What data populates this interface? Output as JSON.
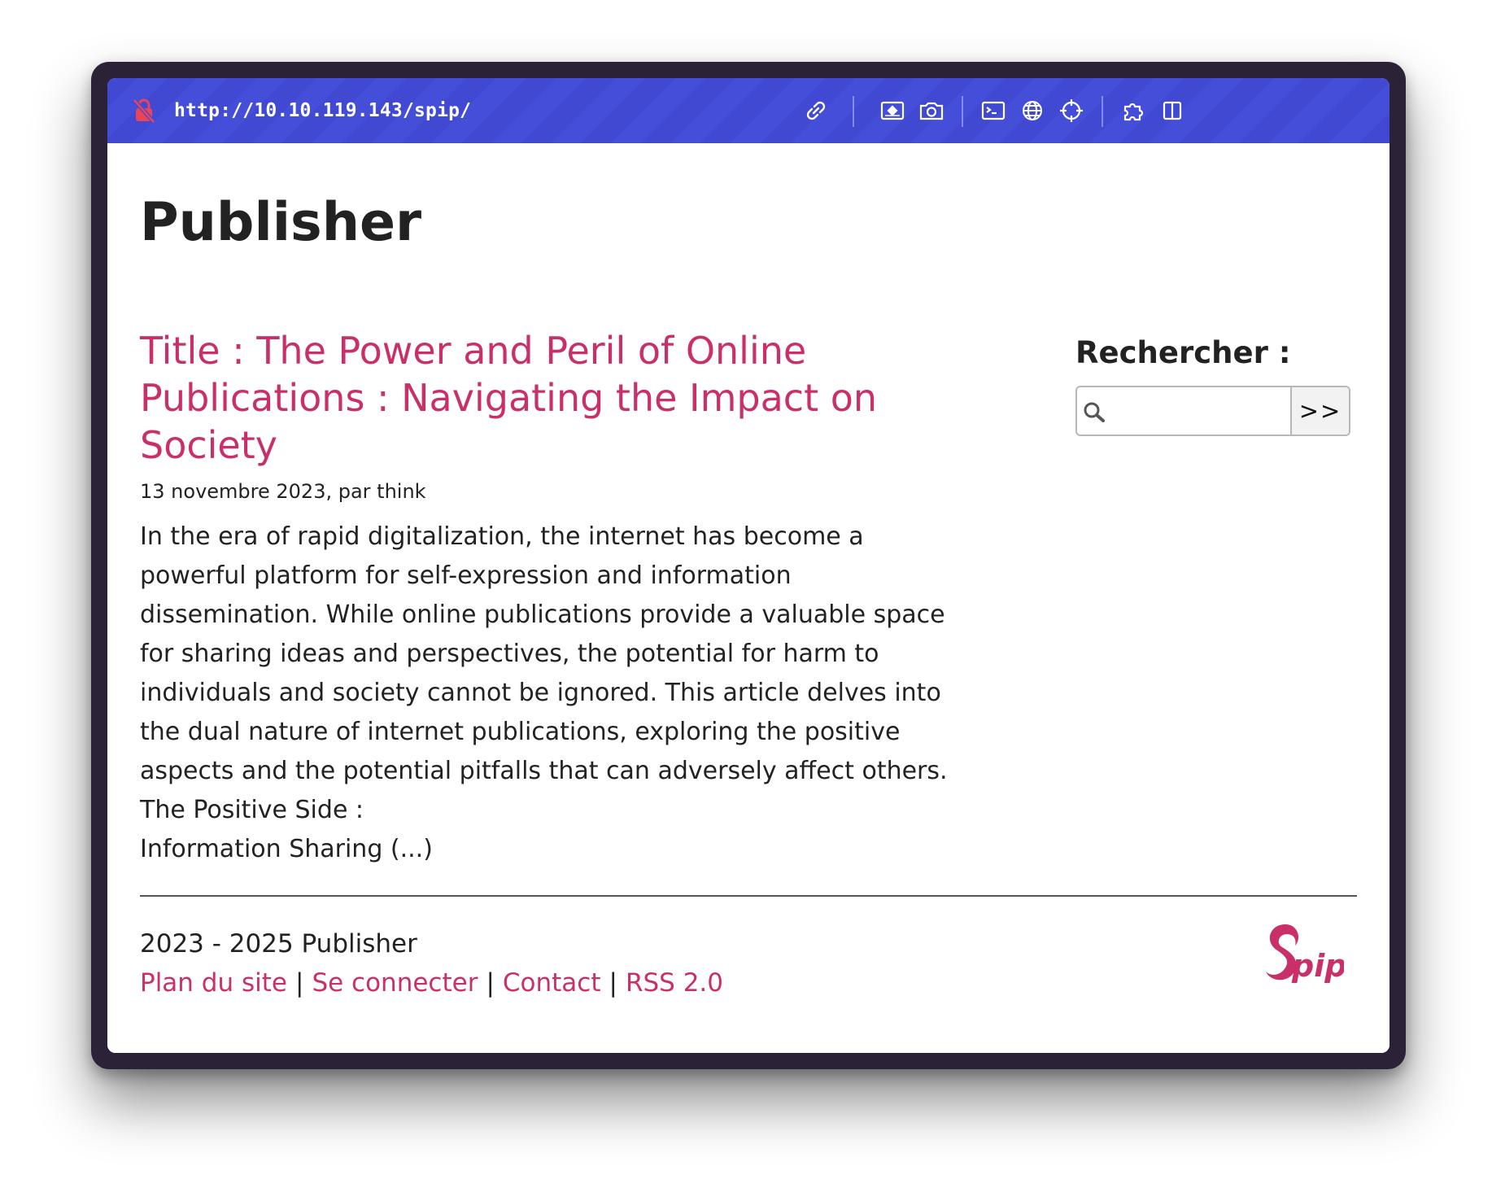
{
  "browser": {
    "url": "http://10.10.119.143/spip/",
    "icons": [
      "lock-slash-icon",
      "link-icon",
      "screenshot-area-icon",
      "camera-icon",
      "terminal-icon",
      "globe-icon",
      "crosshair-icon",
      "extension-icon",
      "sidebar-icon"
    ],
    "accent": "#4149d3"
  },
  "site": {
    "title": "Publisher"
  },
  "article": {
    "title": "Title : The Power and Peril of Online Publications : Navigating the Impact on Society",
    "meta": "13 novembre 2023, par think",
    "intro_lines": [
      "In the era of rapid digitalization, the internet has become a",
      "powerful platform for self-expression and information",
      "dissemination. While online publications provide a valuable space",
      "for sharing ideas and perspectives, the potential for harm to",
      "individuals and society cannot be ignored. This article delves into",
      "the dual nature of internet publications, exploring the positive",
      "aspects and the potential pitfalls that can adversely affect others.",
      "The Positive Side :",
      "Information Sharing (...)"
    ]
  },
  "search": {
    "label": "Rechercher :",
    "value": "",
    "button_label": ">>"
  },
  "footer": {
    "copyright": "2023 - 2025 Publisher",
    "links": [
      "Plan du site",
      "Se connecter",
      "Contact",
      "RSS 2.0"
    ],
    "separator": "|",
    "logo_text": "pip",
    "link_color": "#c9306a"
  }
}
